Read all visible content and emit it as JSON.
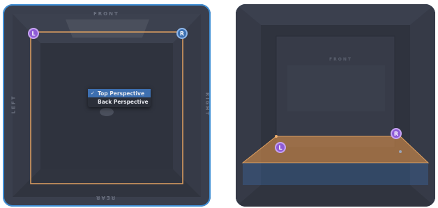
{
  "views": [
    {
      "name": "top-perspective-view",
      "labels": {
        "front": "FRONT",
        "rear": "REAR",
        "left": "LEFT",
        "right": "RIGHT"
      },
      "handles": {
        "left": "L",
        "right": "R"
      },
      "menu": {
        "items": [
          {
            "label": "Top Perspective",
            "selected": true,
            "check": "✓"
          },
          {
            "label": "Back Perspective",
            "selected": false,
            "check": ""
          }
        ]
      }
    },
    {
      "name": "back-perspective-view",
      "labels": {
        "front": "FRONT"
      },
      "handles": {
        "left": "L",
        "right": "R"
      }
    }
  ],
  "colors": {
    "panel_border": "#3f8fd6",
    "selection_outline": "#e0a060",
    "plane_fill": "#d08a4a",
    "left_handle": "#8e5bd6",
    "right_handle": "#3b6fb0"
  }
}
